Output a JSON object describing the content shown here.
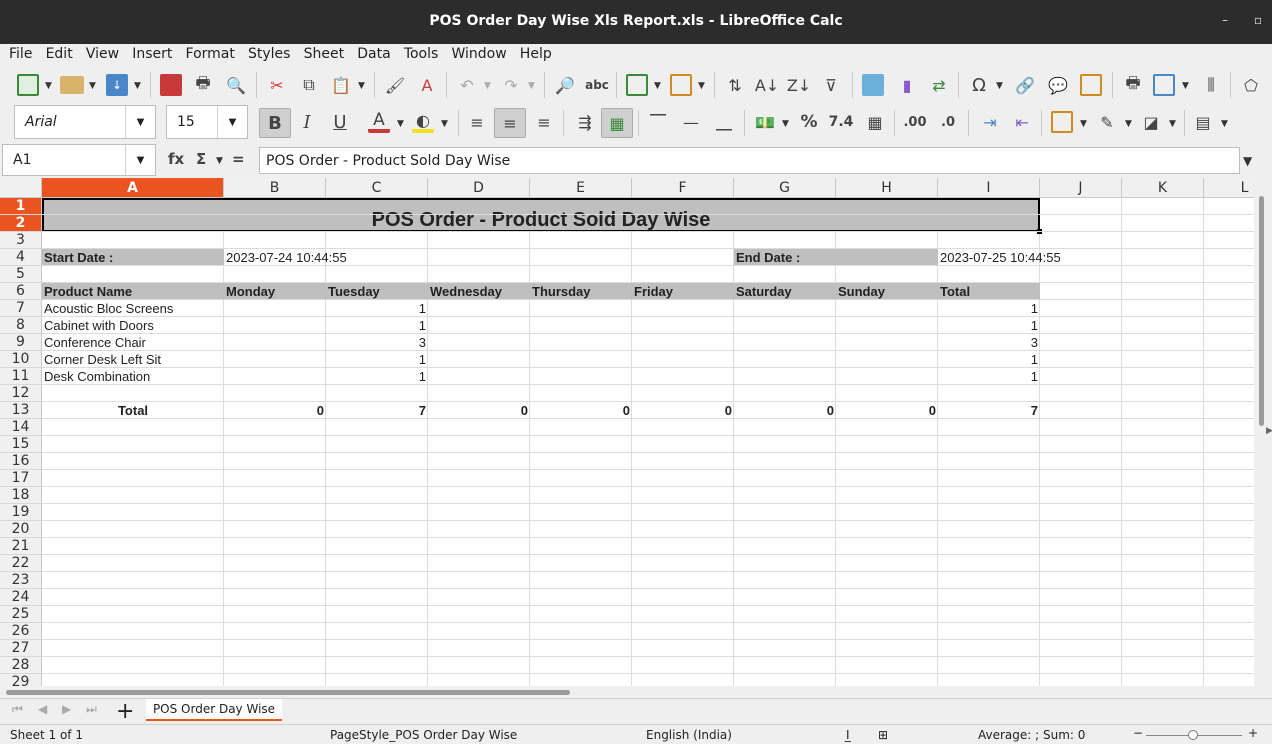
{
  "window": {
    "title": "POS Order Day Wise Xls Report.xls - LibreOffice Calc"
  },
  "menu": [
    "File",
    "Edit",
    "View",
    "Insert",
    "Format",
    "Styles",
    "Sheet",
    "Data",
    "Tools",
    "Window",
    "Help"
  ],
  "format_bar": {
    "font_name": "Arial",
    "font_size": "15"
  },
  "formula_bar": {
    "cell_ref": "A1",
    "func_label": "fx",
    "sum_label": "Σ",
    "equals_label": "=",
    "content": "POS Order - Product Sold Day Wise"
  },
  "columns": [
    "A",
    "B",
    "C",
    "D",
    "E",
    "F",
    "G",
    "H",
    "I",
    "J",
    "K",
    "L"
  ],
  "rows": [
    "1",
    "2",
    "3",
    "4",
    "5",
    "6",
    "7",
    "8",
    "9",
    "10",
    "11",
    "12",
    "13",
    "14",
    "15",
    "16",
    "17",
    "18",
    "19",
    "20",
    "21",
    "22",
    "23",
    "24",
    "25",
    "26",
    "27",
    "28",
    "29"
  ],
  "sheet": {
    "title": "POS Order - Product Sold Day Wise",
    "start_label": "Start Date :",
    "start_value": "2023-07-24 10:44:55",
    "end_label": "End Date :",
    "end_value": "2023-07-25 10:44:55",
    "headers": [
      "Product Name",
      "Monday",
      "Tuesday",
      "Wednesday",
      "Thursday",
      "Friday",
      "Saturday",
      "Sunday",
      "Total"
    ],
    "products": [
      {
        "name": "Acoustic Bloc Screens",
        "tuesday": "1",
        "total": "1"
      },
      {
        "name": "Cabinet with Doors",
        "tuesday": "1",
        "total": "1"
      },
      {
        "name": "Conference Chair",
        "tuesday": "3",
        "total": "3"
      },
      {
        "name": "Corner Desk Left Sit",
        "tuesday": "1",
        "total": "1"
      },
      {
        "name": "Desk Combination",
        "tuesday": "1",
        "total": "1"
      }
    ],
    "totals": {
      "label": "Total",
      "values": [
        "0",
        "7",
        "0",
        "0",
        "0",
        "0",
        "0",
        "7"
      ]
    }
  },
  "tabs": {
    "active": "POS Order Day Wise"
  },
  "status": {
    "sheet": "Sheet 1 of 1",
    "page_style": "PageStyle_POS Order Day Wise",
    "language": "English (India)",
    "summary": "Average: ; Sum: 0"
  },
  "colors": {
    "accent": "#e95420",
    "header_fill": "#bfbfbf",
    "titlebar": "#2c2c2c"
  }
}
